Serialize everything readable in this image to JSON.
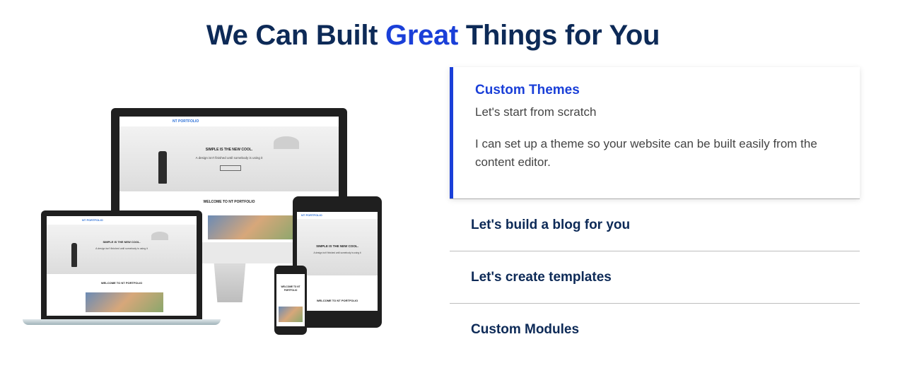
{
  "heading": {
    "part1": "We Can Built ",
    "accent": "Great",
    "part2": " Things for You",
    "accent_color": "#1a3fd8",
    "text_color": "#0d2a57"
  },
  "mockup": {
    "logo": "NT PORTFOLIO",
    "hero_title": "SIMPLE IS THE NEW COOL.",
    "hero_sub": "A design isn't finished until somebody is using it",
    "welcome": "WELCOME TO NT PORTFOLIO"
  },
  "accordion": {
    "active": {
      "title": "Custom Themes",
      "subtitle": "Let's start from scratch",
      "body": "I can set up a theme so your website can be built easily from the content editor."
    },
    "items": [
      {
        "label": "Let's build a blog for you"
      },
      {
        "label": "Let's create templates"
      },
      {
        "label": "Custom Modules"
      }
    ]
  }
}
